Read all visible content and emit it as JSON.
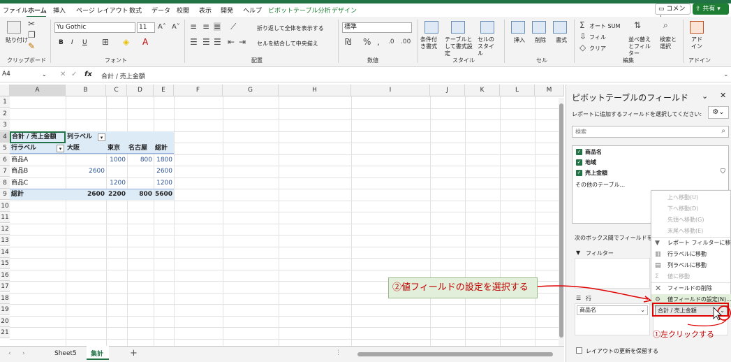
{
  "menu": {
    "file": "ファイル",
    "home": "ホーム",
    "insert": "挿入",
    "page_layout": "ページ レイアウト",
    "formulas": "数式",
    "data": "データ",
    "review": "校閲",
    "view": "表示",
    "developer": "開発",
    "help": "ヘルプ",
    "pivot_analyze": "ピボットテーブル分析",
    "design": "デザイン",
    "comment": "コメント",
    "share": "共有"
  },
  "ribbon": {
    "paste": "貼り付け",
    "clipboard": "クリップボード",
    "font_name": "Yu Gothic",
    "font_size": "11",
    "bold": "B",
    "italic": "I",
    "underline": "U",
    "font": "フォント",
    "wrap_text": "折り返して全体を表示する",
    "merge_center": "セルを結合して中央揃え",
    "alignment": "配置",
    "number_format": "標準",
    "number": "数値",
    "cond_format": "条件付き書式",
    "format_table": "テーブルとして書式設定",
    "cell_styles": "セルのスタイル",
    "styles": "スタイル",
    "insert_cell": "挿入",
    "delete_cell": "削除",
    "format_cell": "書式",
    "cells": "セル",
    "autosum": "オート SUM",
    "fill": "フィル",
    "clear": "クリア",
    "sort_filter": "並べ替えとフィルター",
    "find_select": "検索と選択",
    "editing": "編集",
    "addins": "アドイン"
  },
  "formula_bar": {
    "name_box": "A4",
    "fx": "fx",
    "formula": "合計 / 売上金額"
  },
  "columns": [
    "A",
    "B",
    "C",
    "D",
    "E",
    "F",
    "G",
    "H",
    "I",
    "J",
    "K",
    "L",
    "M"
  ],
  "rows": [
    "1",
    "2",
    "3",
    "4",
    "5",
    "6",
    "7",
    "8",
    "9",
    "10",
    "11",
    "12",
    "13",
    "14",
    "15",
    "16",
    "17",
    "18",
    "19",
    "20",
    "21"
  ],
  "pivot": {
    "value_header": "合計 / 売上金額",
    "col_labels": "列ラベル",
    "row_labels": "行ラベル",
    "col_osaka": "大阪",
    "col_tokyo": "東京",
    "col_nagoya": "名古屋",
    "col_total": "総計",
    "rows": [
      {
        "label": "商品A",
        "osaka": "",
        "tokyo": "1000",
        "nagoya": "800",
        "total": "1800"
      },
      {
        "label": "商品B",
        "osaka": "2600",
        "tokyo": "",
        "nagoya": "",
        "total": "2600"
      },
      {
        "label": "商品C",
        "osaka": "",
        "tokyo": "1200",
        "nagoya": "",
        "total": "1200"
      }
    ],
    "grand": {
      "label": "総計",
      "osaka": "2600",
      "tokyo": "2200",
      "nagoya": "800",
      "total": "5600"
    }
  },
  "tabs": {
    "sheet5": "Sheet5",
    "active": "集計",
    "add": "+"
  },
  "pane": {
    "title": "ピボットテーブルのフィールド",
    "subtitle": "レポートに追加するフィールドを選択してください:",
    "search_placeholder": "検索",
    "fields": [
      "商品名",
      "地域",
      "売上金額"
    ],
    "more_tables": "その他のテーブル...",
    "drag_hint": "次のボックス間でフィールドをドラッグ",
    "filter": "フィルター",
    "rows": "行",
    "row_field": "商品名",
    "value_field": "合計 / 売上金額",
    "defer_update": "レイアウトの更新を保留する"
  },
  "context_menu": {
    "items": [
      {
        "label": "上へ移動(U)",
        "enabled": false,
        "icon": ""
      },
      {
        "label": "下へ移動(D)",
        "enabled": false,
        "icon": ""
      },
      {
        "label": "先頭へ移動(G)",
        "enabled": false,
        "icon": ""
      },
      {
        "label": "末尾へ移動(E)",
        "enabled": false,
        "icon": ""
      },
      {
        "label": "レポート フィルターに移動",
        "enabled": true,
        "icon": "filter-icon"
      },
      {
        "label": "行ラベルに移動",
        "enabled": true,
        "icon": "rows-icon"
      },
      {
        "label": "列ラベルに移動",
        "enabled": true,
        "icon": "columns-icon"
      },
      {
        "label": "値に移動",
        "enabled": false,
        "icon": "sigma-icon"
      },
      {
        "label": "フィールドの削除",
        "enabled": true,
        "icon": "delete-icon"
      },
      {
        "label": "値フィールドの設定(N)...",
        "enabled": true,
        "icon": "settings-icon"
      }
    ]
  },
  "annotations": {
    "step2": "②値フィールドの設定を選択する",
    "step1": "①左クリックする"
  },
  "colors": {
    "excel_green": "#217346",
    "pivot_header_bg": "#ddebf7",
    "annotation_red": "#c00000",
    "annotation_bg": "#e2efda"
  }
}
